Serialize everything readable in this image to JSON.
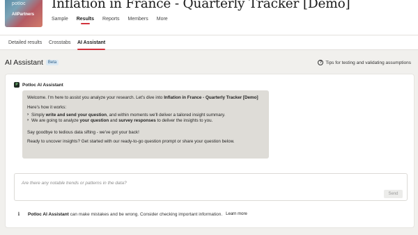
{
  "thumbnail": {
    "logo": "potloc",
    "word": "AllPartners"
  },
  "project": {
    "title": "Inflation in France - Quarterly Tracker [Demo]"
  },
  "nav": {
    "items": [
      "Sample",
      "Results",
      "Reports",
      "Members",
      "More"
    ],
    "active": "Results"
  },
  "subtabs": {
    "items": [
      "Detailed results",
      "Crosstabs",
      "AI Assistant"
    ],
    "active": "AI Assistant"
  },
  "page": {
    "title": "AI Assistant",
    "badge": "Beta",
    "tips": "Tips for testing and validating assumptions"
  },
  "assistant": {
    "name": "Potloc AI Assistant",
    "welcome_pre": "Welcome. I'm here to assist you analyze your research. Let's dive into ",
    "welcome_bold": "Inflation in France - Quarterly Tracker [Demo]",
    "how": "Here's how it works:",
    "b1_pre": "Simply ",
    "b1_bold": "write and send your question",
    "b1_post": ", and within moments we'll deliver a tailored insight summary.",
    "b2_pre": "We are going to analyze ",
    "b2_bold1": "your question",
    "b2_mid": " and ",
    "b2_bold2": "survey responses",
    "b2_post": " to deliver the insights to you.",
    "goodbye": "Say goodbye to tedious data sifting - we've got your back!",
    "ready": "Ready to uncover insights? Get started with our ready-to-go question prompt or share your question below."
  },
  "input": {
    "placeholder": "Are there any notable trends or patterns in the data?",
    "send": "Send"
  },
  "disclaimer": {
    "bold": "Potloc AI Assistant",
    "text": " can make mistakes and be wrong. Consider checking important information.",
    "link": "Learn more"
  },
  "colors": {
    "accent": "#d2323c",
    "bubble": "#dedcd7",
    "background": "#f1f0ed"
  }
}
